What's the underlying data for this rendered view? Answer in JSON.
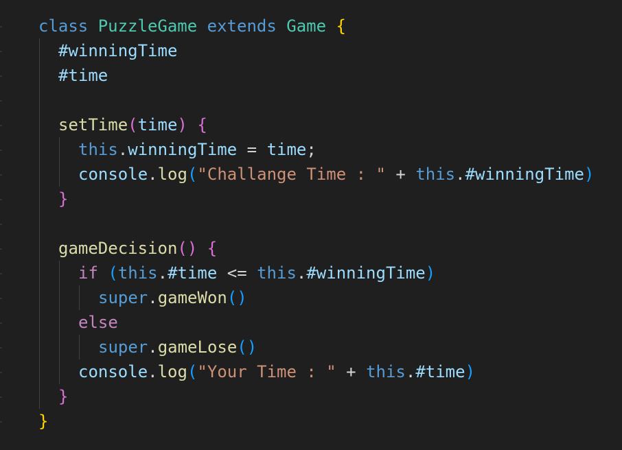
{
  "colors": {
    "background": "#1f1f1f",
    "default": "#d4d4d4",
    "keyword": "#569cd6",
    "control": "#c586c0",
    "class_name": "#4ec9b0",
    "function": "#dcdcaa",
    "variable": "#9cdcfe",
    "string": "#ce9178",
    "bracket_gold": "#ffd700",
    "bracket_purple": "#da70d6",
    "bracket_blue": "#179fff",
    "indent_guide": "#404040"
  },
  "code": {
    "lines": [
      {
        "indent": 1,
        "tokens": [
          {
            "t": "class",
            "c": "keyword"
          },
          {
            "t": " ",
            "c": "default"
          },
          {
            "t": "PuzzleGame",
            "c": "class_name"
          },
          {
            "t": " ",
            "c": "default"
          },
          {
            "t": "extends",
            "c": "keyword"
          },
          {
            "t": " ",
            "c": "default"
          },
          {
            "t": "Game",
            "c": "class_name"
          },
          {
            "t": " ",
            "c": "default"
          },
          {
            "t": "{",
            "c": "bracket_gold"
          }
        ]
      },
      {
        "indent": 2,
        "tokens": [
          {
            "t": "#winningTime",
            "c": "variable"
          }
        ]
      },
      {
        "indent": 2,
        "tokens": [
          {
            "t": "#time",
            "c": "variable"
          }
        ]
      },
      {
        "indent": 0,
        "tokens": []
      },
      {
        "indent": 2,
        "tokens": [
          {
            "t": "setTime",
            "c": "function"
          },
          {
            "t": "(",
            "c": "bracket_purple"
          },
          {
            "t": "time",
            "c": "variable"
          },
          {
            "t": ")",
            "c": "bracket_purple"
          },
          {
            "t": " ",
            "c": "default"
          },
          {
            "t": "{",
            "c": "bracket_purple"
          }
        ]
      },
      {
        "indent": 3,
        "tokens": [
          {
            "t": "this",
            "c": "keyword"
          },
          {
            "t": ".",
            "c": "default"
          },
          {
            "t": "winningTime",
            "c": "variable"
          },
          {
            "t": " = ",
            "c": "default"
          },
          {
            "t": "time",
            "c": "variable"
          },
          {
            "t": ";",
            "c": "default"
          }
        ]
      },
      {
        "indent": 3,
        "tokens": [
          {
            "t": "console",
            "c": "variable"
          },
          {
            "t": ".",
            "c": "default"
          },
          {
            "t": "log",
            "c": "function"
          },
          {
            "t": "(",
            "c": "bracket_blue"
          },
          {
            "t": "\"Challange Time : \"",
            "c": "string"
          },
          {
            "t": " + ",
            "c": "default"
          },
          {
            "t": "this",
            "c": "keyword"
          },
          {
            "t": ".",
            "c": "default"
          },
          {
            "t": "#winningTime",
            "c": "variable"
          },
          {
            "t": ")",
            "c": "bracket_blue"
          }
        ]
      },
      {
        "indent": 2,
        "tokens": [
          {
            "t": "}",
            "c": "bracket_purple"
          }
        ]
      },
      {
        "indent": 0,
        "tokens": []
      },
      {
        "indent": 2,
        "tokens": [
          {
            "t": "gameDecision",
            "c": "function"
          },
          {
            "t": "()",
            "c": "bracket_purple"
          },
          {
            "t": " ",
            "c": "default"
          },
          {
            "t": "{",
            "c": "bracket_purple"
          }
        ]
      },
      {
        "indent": 3,
        "tokens": [
          {
            "t": "if",
            "c": "control"
          },
          {
            "t": " ",
            "c": "default"
          },
          {
            "t": "(",
            "c": "bracket_blue"
          },
          {
            "t": "this",
            "c": "keyword"
          },
          {
            "t": ".",
            "c": "default"
          },
          {
            "t": "#time",
            "c": "variable"
          },
          {
            "t": " <= ",
            "c": "default"
          },
          {
            "t": "this",
            "c": "keyword"
          },
          {
            "t": ".",
            "c": "default"
          },
          {
            "t": "#winningTime",
            "c": "variable"
          },
          {
            "t": ")",
            "c": "bracket_blue"
          }
        ]
      },
      {
        "indent": 4,
        "tokens": [
          {
            "t": "super",
            "c": "keyword"
          },
          {
            "t": ".",
            "c": "default"
          },
          {
            "t": "gameWon",
            "c": "function"
          },
          {
            "t": "()",
            "c": "bracket_blue"
          }
        ]
      },
      {
        "indent": 3,
        "tokens": [
          {
            "t": "else",
            "c": "control"
          }
        ]
      },
      {
        "indent": 4,
        "tokens": [
          {
            "t": "super",
            "c": "keyword"
          },
          {
            "t": ".",
            "c": "default"
          },
          {
            "t": "gameLose",
            "c": "function"
          },
          {
            "t": "()",
            "c": "bracket_blue"
          }
        ]
      },
      {
        "indent": 3,
        "tokens": [
          {
            "t": "console",
            "c": "variable"
          },
          {
            "t": ".",
            "c": "default"
          },
          {
            "t": "log",
            "c": "function"
          },
          {
            "t": "(",
            "c": "bracket_blue"
          },
          {
            "t": "\"Your Time : \"",
            "c": "string"
          },
          {
            "t": " + ",
            "c": "default"
          },
          {
            "t": "this",
            "c": "keyword"
          },
          {
            "t": ".",
            "c": "default"
          },
          {
            "t": "#time",
            "c": "variable"
          },
          {
            "t": ")",
            "c": "bracket_blue"
          }
        ]
      },
      {
        "indent": 2,
        "tokens": [
          {
            "t": "}",
            "c": "bracket_purple"
          }
        ]
      },
      {
        "indent": 1,
        "tokens": [
          {
            "t": "}",
            "c": "bracket_gold"
          }
        ]
      }
    ]
  }
}
